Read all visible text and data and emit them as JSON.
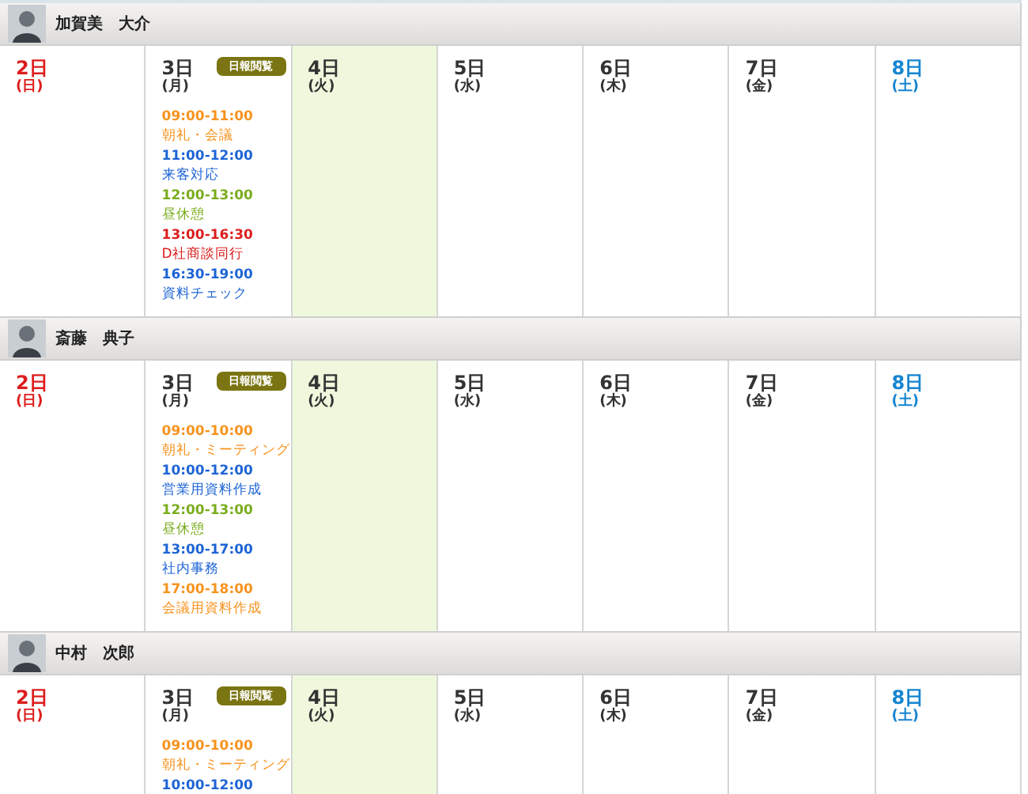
{
  "people": [
    {
      "name": "加賀美　大介",
      "days": [
        {
          "date": "2日",
          "weekday": "(日)",
          "kind": "sunday",
          "today": false
        },
        {
          "date": "3日",
          "weekday": "(月)",
          "kind": "weekday",
          "today": false,
          "badge": "日報閲覧",
          "events": [
            {
              "time": "09:00-11:00",
              "title": "朝礼・会議",
              "color": "#f7931e"
            },
            {
              "time": "11:00-12:00",
              "title": "来客対応",
              "color": "#1d64d6"
            },
            {
              "time": "12:00-13:00",
              "title": "昼休憩",
              "color": "#7aac1c"
            },
            {
              "time": "13:00-16:30",
              "title": "D社商談同行",
              "color": "#dd1d1d"
            },
            {
              "time": "16:30-19:00",
              "title": "資料チェック",
              "color": "#1d64d6"
            }
          ]
        },
        {
          "date": "4日",
          "weekday": "(火)",
          "kind": "weekday",
          "today": true
        },
        {
          "date": "5日",
          "weekday": "(水)",
          "kind": "weekday",
          "today": false
        },
        {
          "date": "6日",
          "weekday": "(木)",
          "kind": "weekday",
          "today": false
        },
        {
          "date": "7日",
          "weekday": "(金)",
          "kind": "weekday",
          "today": false
        },
        {
          "date": "8日",
          "weekday": "(土)",
          "kind": "saturday",
          "today": false
        }
      ]
    },
    {
      "name": "斎藤　典子",
      "days": [
        {
          "date": "2日",
          "weekday": "(日)",
          "kind": "sunday",
          "today": false
        },
        {
          "date": "3日",
          "weekday": "(月)",
          "kind": "weekday",
          "today": false,
          "badge": "日報閲覧",
          "events": [
            {
              "time": "09:00-10:00",
              "title": "朝礼・ミーティング",
              "color": "#f7931e"
            },
            {
              "time": "10:00-12:00",
              "title": "営業用資料作成",
              "color": "#1d64d6"
            },
            {
              "time": "12:00-13:00",
              "title": "昼休憩",
              "color": "#7aac1c"
            },
            {
              "time": "13:00-17:00",
              "title": "社内事務",
              "color": "#1d64d6"
            },
            {
              "time": "17:00-18:00",
              "title": "会議用資料作成",
              "color": "#f7931e"
            }
          ]
        },
        {
          "date": "4日",
          "weekday": "(火)",
          "kind": "weekday",
          "today": true
        },
        {
          "date": "5日",
          "weekday": "(水)",
          "kind": "weekday",
          "today": false
        },
        {
          "date": "6日",
          "weekday": "(木)",
          "kind": "weekday",
          "today": false
        },
        {
          "date": "7日",
          "weekday": "(金)",
          "kind": "weekday",
          "today": false
        },
        {
          "date": "8日",
          "weekday": "(土)",
          "kind": "saturday",
          "today": false
        }
      ]
    },
    {
      "name": "中村　次郎",
      "days": [
        {
          "date": "2日",
          "weekday": "(日)",
          "kind": "sunday",
          "today": false
        },
        {
          "date": "3日",
          "weekday": "(月)",
          "kind": "weekday",
          "today": false,
          "badge": "日報閲覧",
          "events": [
            {
              "time": "09:00-10:00",
              "title": "朝礼・ミーティング",
              "color": "#f7931e"
            },
            {
              "time": "10:00-12:00",
              "color": "#1d64d6"
            }
          ]
        },
        {
          "date": "4日",
          "weekday": "(火)",
          "kind": "weekday",
          "today": true
        },
        {
          "date": "5日",
          "weekday": "(水)",
          "kind": "weekday",
          "today": false
        },
        {
          "date": "6日",
          "weekday": "(木)",
          "kind": "weekday",
          "today": false
        },
        {
          "date": "7日",
          "weekday": "(金)",
          "kind": "weekday",
          "today": false
        },
        {
          "date": "8日",
          "weekday": "(土)",
          "kind": "saturday",
          "today": false
        }
      ]
    }
  ]
}
